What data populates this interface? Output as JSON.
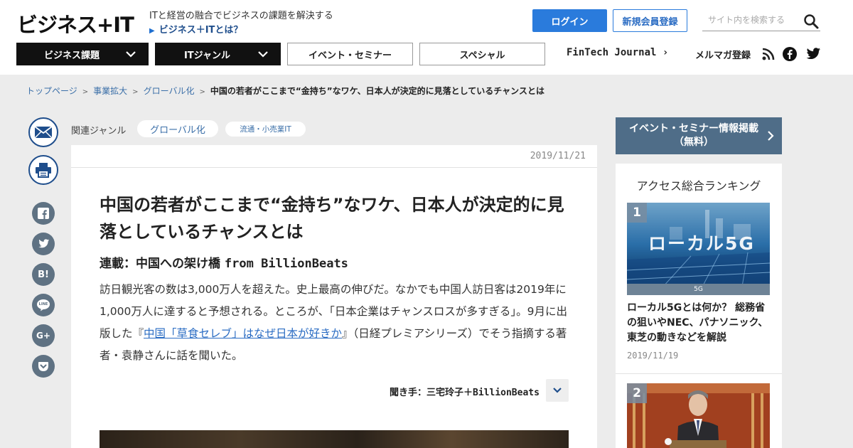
{
  "header": {
    "logo": "ビジネス+IT",
    "tagline": "ITと経営の融合でビジネスの課題を解決する",
    "about_link": "ビジネス＋ITとは？",
    "login": "ログイン",
    "register": "新規会員登録",
    "search_placeholder": "サイト内を検索する"
  },
  "nav": {
    "business": "ビジネス課題",
    "it_genre": "ITジャンル",
    "events": "イベント・セミナー",
    "special": "スペシャル",
    "fintech": "FinTech Journal",
    "newsletter": "メルマガ登録"
  },
  "breadcrumb": {
    "items": [
      "トップページ",
      "事業拡大",
      "グローバル化"
    ],
    "separator": ">",
    "current": "中国の若者がここまで“金持ち”なワケ、日本人が決定的に見落としているチャンスとは"
  },
  "share": {
    "facebook": "f",
    "hatena": "B!",
    "line": "LINE",
    "gplus": "G+"
  },
  "article": {
    "genre_label": "関連ジャンル",
    "tags": [
      "グローバル化",
      "流通・小売業IT"
    ],
    "date": "2019/11/21",
    "title": "中国の若者がここまで“金持ち”なワケ、日本人が決定的に見落としているチャンスとは",
    "series_prefix": "連載：中国への架け橋 ",
    "series_name": "from BillionBeats",
    "lead_part1": "訪日観光客の数は3,000万人を超えた。史上最高の伸びだ。なかでも中国人訪日客は2019年に1,000万人に達すると予想される。ところが、「日本企業はチャンスロスが多すぎる」。9月に出版した『",
    "lead_link": "中国「草食セレブ」はなぜ日本が好きか",
    "lead_part2": "』（日経プレミアシリーズ）でそう指摘する著者・袁静さんに話を聞いた。",
    "interviewer_prefix": "聞き手：三宅玲子＋",
    "interviewer_name": "BillionBeats"
  },
  "sidebar": {
    "event_banner_line1": "イベント・セミナー情報掲載",
    "event_banner_line2": "（無料）",
    "ranking_title": "アクセス総合ランキング",
    "items": [
      {
        "rank": "1",
        "image_text": "ローカル5G",
        "image_caption": "5G",
        "headline": "ローカル5Gとは何か？ 総務省の狙いやNEC、パナソニック、東芝の動きなどを解説",
        "date": "2019/11/19"
      },
      {
        "rank": "2"
      }
    ]
  },
  "colors": {
    "brand_blue": "#2a7bdc",
    "nav_dark": "#111111",
    "banner": "#4f6d88",
    "share_gray": "#5f7283"
  }
}
